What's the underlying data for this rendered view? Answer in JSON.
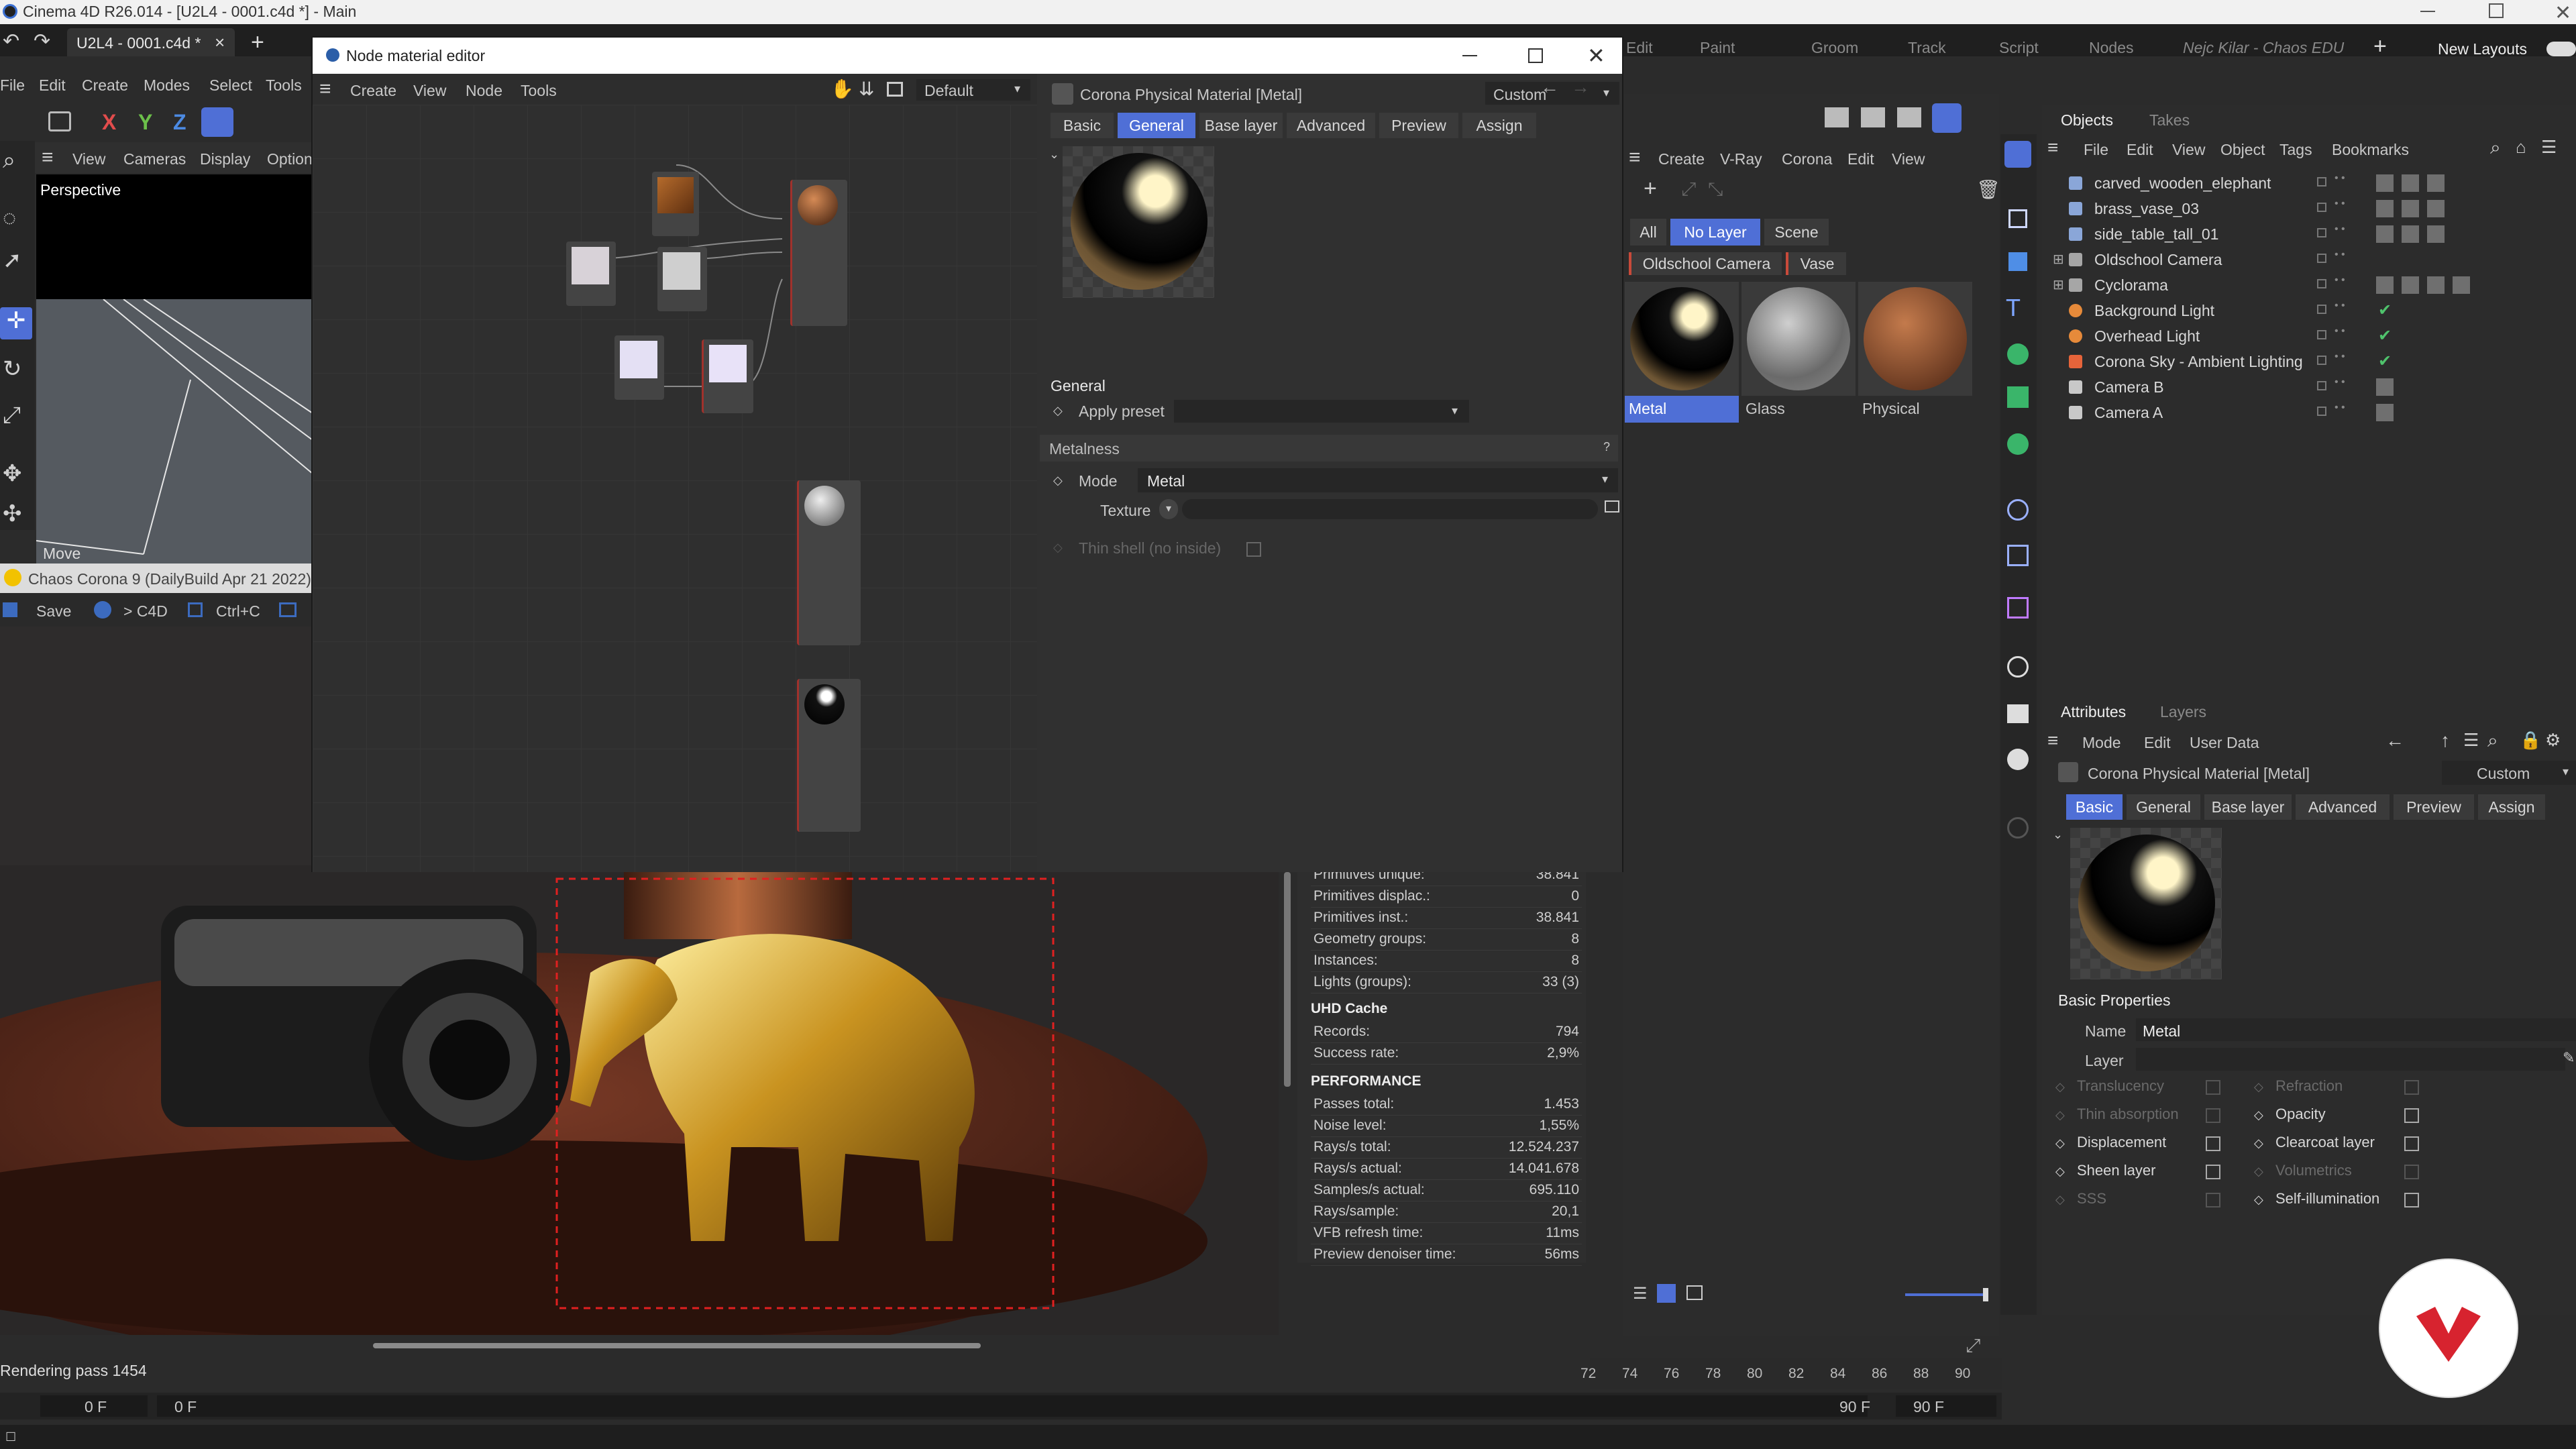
{
  "window": {
    "title": "Cinema 4D R26.014 - [U2L4 - 0001.c4d *] - Main"
  },
  "tab": {
    "label": "U2L4 - 0001.c4d *"
  },
  "main_menu": [
    "File",
    "Edit",
    "Create",
    "Modes",
    "Select",
    "Tools"
  ],
  "top_menu": [
    "Edit",
    "Paint",
    "Groom",
    "Track",
    "Script",
    "Nodes"
  ],
  "user_label": "Nejc Kilar - Chaos EDU",
  "new_layouts": "New Layouts",
  "axis_buttons": [
    "X",
    "Y",
    "Z"
  ],
  "viewport": {
    "menu": [
      "View",
      "Cameras",
      "Display",
      "Option"
    ],
    "label": "Perspective",
    "move_label": "Move"
  },
  "corona_bar": {
    "title": "Chaos Corona 9 (DailyBuild Apr 21 2022)",
    "save": "Save",
    "to_c4d": "> C4D",
    "shortcut": "Ctrl+C"
  },
  "node_editor": {
    "title": "Node material editor",
    "menu": [
      "Create",
      "View",
      "Node",
      "Tools"
    ],
    "layout_select": "Default",
    "material_title": "Corona Physical Material [Metal]",
    "preset_select": "Custom",
    "tabs": [
      "Basic",
      "General",
      "Base layer",
      "Advanced",
      "Preview",
      "Assign"
    ],
    "active_tab": "General",
    "section_general": "General",
    "apply_preset": "Apply preset",
    "section_metalness": "Metalness",
    "mode_label": "Mode",
    "mode_value": "Metal",
    "texture_label": "Texture",
    "thin_shell": "Thin shell (no inside)"
  },
  "material_manager": {
    "menu": [
      "Create",
      "V-Ray",
      "Corona",
      "Edit",
      "View"
    ],
    "filters": [
      "All",
      "No Layer",
      "Scene"
    ],
    "active_filter": "No Layer",
    "layers": [
      "Oldschool Camera",
      "Vase"
    ],
    "materials": [
      {
        "name": "Metal"
      },
      {
        "name": "Glass"
      },
      {
        "name": "Physical"
      }
    ]
  },
  "render_stats": {
    "rows_top": [
      {
        "label": "Primitives unique:",
        "value": "38.841"
      },
      {
        "label": "Primitives displac.:",
        "value": "0"
      },
      {
        "label": "Primitives inst.:",
        "value": "38.841"
      },
      {
        "label": "Geometry groups:",
        "value": "8"
      },
      {
        "label": "Instances:",
        "value": "8"
      },
      {
        "label": "Lights (groups):",
        "value": "33 (3)"
      }
    ],
    "uhd_title": "UHD Cache",
    "uhd_rows": [
      {
        "label": "Records:",
        "value": "794"
      },
      {
        "label": "Success rate:",
        "value": "2,9%"
      }
    ],
    "perf_title": "PERFORMANCE",
    "perf_rows": [
      {
        "label": "Passes total:",
        "value": "1.453"
      },
      {
        "label": "Noise level:",
        "value": "1,55%"
      },
      {
        "label": "Rays/s total:",
        "value": "12.524.237"
      },
      {
        "label": "Rays/s actual:",
        "value": "14.041.678"
      },
      {
        "label": "Samples/s actual:",
        "value": "695.110"
      },
      {
        "label": "Rays/sample:",
        "value": "20,1"
      },
      {
        "label": "VFB refresh time:",
        "value": "11ms"
      },
      {
        "label": "Preview denoiser time:",
        "value": "56ms"
      }
    ]
  },
  "status": {
    "text": "Rendering pass 1454"
  },
  "timeline": {
    "ticks": [
      "72",
      "74",
      "76",
      "78",
      "80",
      "82",
      "84",
      "86",
      "88",
      "90"
    ],
    "start_frame": "0 F",
    "current_frame": "0 F",
    "end_a": "90 F",
    "end_b": "90 F"
  },
  "objects_panel": {
    "tabs": [
      "Objects",
      "Takes"
    ],
    "menu": [
      "File",
      "Edit",
      "View",
      "Object",
      "Tags",
      "Bookmarks"
    ],
    "items": [
      {
        "name": "carved_wooden_elephant",
        "type": "mesh",
        "tags": 3
      },
      {
        "name": "brass_vase_03",
        "type": "mesh",
        "tags": 3
      },
      {
        "name": "side_table_tall_01",
        "type": "mesh",
        "tags": 3
      },
      {
        "name": "Oldschool Camera",
        "type": "group",
        "tags": 0
      },
      {
        "name": "Cyclorama",
        "type": "group",
        "tags": 4
      },
      {
        "name": "Background Light",
        "type": "light",
        "tags": 1
      },
      {
        "name": "Overhead Light",
        "type": "light",
        "tags": 1
      },
      {
        "name": "Corona Sky - Ambient Lighting",
        "type": "sky",
        "tags": 1
      },
      {
        "name": "Camera B",
        "type": "camera",
        "tags": 1
      },
      {
        "name": "Camera A",
        "type": "camera",
        "tags": 1
      }
    ]
  },
  "attributes_panel": {
    "tabs": [
      "Attributes",
      "Layers"
    ],
    "menu": [
      "Mode",
      "Edit",
      "User Data"
    ],
    "material_title": "Corona Physical Material [Metal]",
    "preset": "Custom",
    "tabs2": [
      "Basic",
      "General",
      "Base layer",
      "Advanced",
      "Preview",
      "Assign"
    ],
    "active_tab": "Basic",
    "section": "Basic Properties",
    "name_label": "Name",
    "name_value": "Metal",
    "layer_label": "Layer",
    "checks_left": [
      {
        "label": "Translucency",
        "enabled": false
      },
      {
        "label": "Thin absorption",
        "enabled": false
      },
      {
        "label": "Displacement",
        "enabled": true
      },
      {
        "label": "Sheen layer",
        "enabled": true
      },
      {
        "label": "SSS",
        "enabled": false
      }
    ],
    "checks_right": [
      {
        "label": "Refraction",
        "enabled": false
      },
      {
        "label": "Opacity",
        "enabled": true
      },
      {
        "label": "Clearcoat layer",
        "enabled": true
      },
      {
        "label": "Volumetrics",
        "enabled": false
      },
      {
        "label": "Self-illumination",
        "enabled": true
      }
    ]
  },
  "colors": {
    "accent": "#4f6fd6",
    "bg": "#2b2b2b",
    "title_bar": "#f3f3f3",
    "logo": "#d7232f"
  }
}
